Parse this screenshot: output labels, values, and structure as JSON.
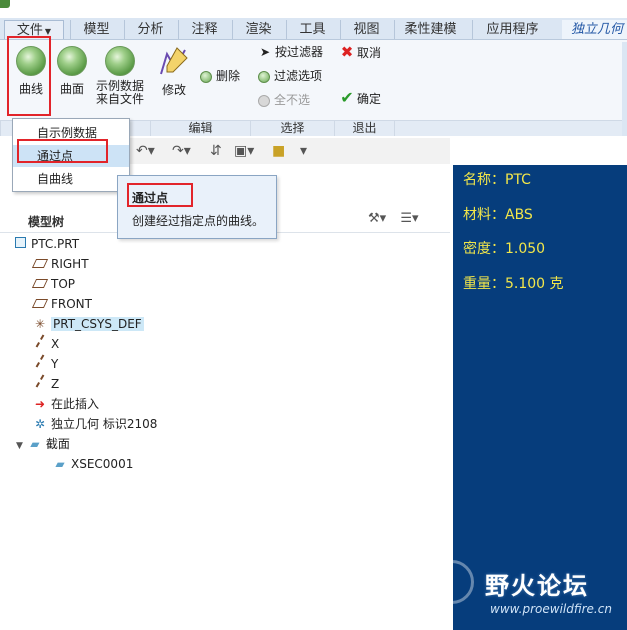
{
  "tabs": [
    "文件",
    "模型",
    "分析",
    "注释",
    "渲染",
    "工具",
    "视图",
    "柔性建模",
    "应用程序",
    "独立几何"
  ],
  "ribbon": {
    "curve_label": "曲线",
    "surface_label": "曲面",
    "instance_label_1": "示例数据",
    "instance_label_2": "来自文件",
    "modify_label": "修改",
    "delete_label": "删除",
    "filter_label": "按过滤器",
    "filter_options_label": "过滤选项",
    "deselect_all_label": "全不选",
    "cancel_label": "取消",
    "ok_label": "确定",
    "groups": [
      "编辑",
      "选择",
      "退出"
    ]
  },
  "dropdown": {
    "items": [
      "自示例数据",
      "通过点",
      "自曲线"
    ]
  },
  "tooltip": {
    "title": "通过点",
    "description": "创建经过指定点的曲线。"
  },
  "tree": {
    "title": "模型树",
    "nodes": [
      "PTC.PRT",
      "RIGHT",
      "TOP",
      "FRONT",
      "PRT_CSYS_DEF",
      "X",
      "Y",
      "Z",
      "在此插入",
      "独立几何 标识2108",
      "截面",
      "XSEC0001"
    ]
  },
  "viewport_info": {
    "name": "名称：PTC",
    "material": "材料：ABS",
    "density": "密度：1.050",
    "weight": "重量：5.100 克"
  },
  "watermark": {
    "name": "野火论坛",
    "url": "www.proewildfire.cn"
  },
  "colors": {
    "viewport_bg": "#063d7c",
    "info_text": "#f2e64a",
    "highlight_red": "#e2242a"
  }
}
